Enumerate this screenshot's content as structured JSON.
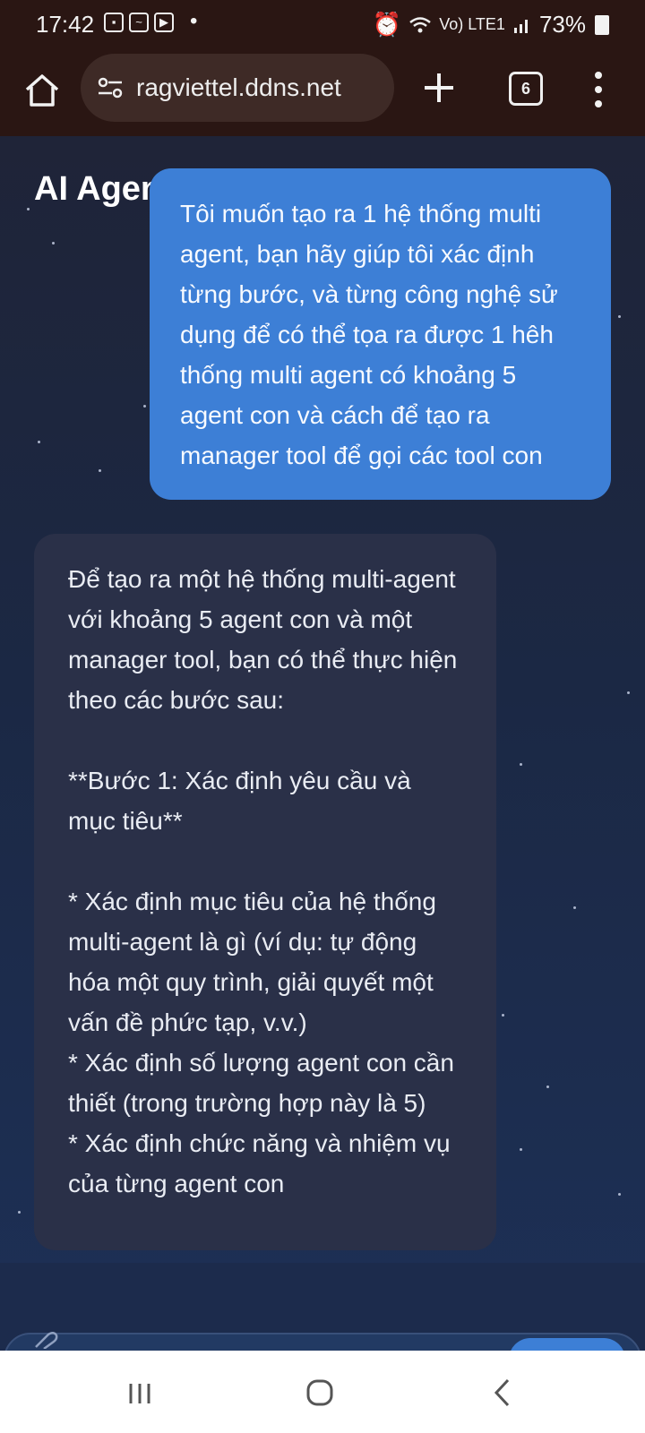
{
  "status_bar": {
    "time": "17:42",
    "network": "Vo) LTE1",
    "battery": "73%"
  },
  "browser": {
    "url": "ragviettel.ddns.net",
    "tab_count": "6"
  },
  "app": {
    "title": "AI Agent"
  },
  "chat": {
    "user_message": "Tôi muốn tạo ra 1 hệ thống multi agent, bạn hãy giúp tôi xác định từng bước, và từng công nghệ sử dụng để có thể tọa ra được 1 hêh thống multi agent có khoảng 5 agent con và cách để tạo ra manager tool để gọi các tool con",
    "assistant_message": "Để tạo ra một hệ thống multi-agent với khoảng 5 agent con và một manager tool, bạn có thể thực hiện theo các bước sau:\n\n**Bước 1: Xác định yêu cầu và mục tiêu**\n\n* Xác định mục tiêu của hệ thống multi-agent là gì (ví dụ: tự động hóa một quy trình, giải quyết một vấn đề phức tạp, v.v.)\n* Xác định số lượng agent con cần thiết (trong trường hợp này là 5)\n* Xác định chức năng và nhiệm vụ của từng agent con"
  },
  "icons": {
    "home": "home-icon",
    "site_settings": "tune-icon",
    "new_tab": "plus-icon",
    "tabs": "tabs-icon",
    "menu": "more-vert-icon",
    "attach": "attach-icon",
    "nav_recent": "recent-apps-icon",
    "nav_home": "home-circle-icon",
    "nav_back": "back-icon"
  },
  "colors": {
    "user_bubble": "#3d7fd6",
    "assistant_bubble": "#2a3048",
    "browser_bar": "#2a1613"
  }
}
